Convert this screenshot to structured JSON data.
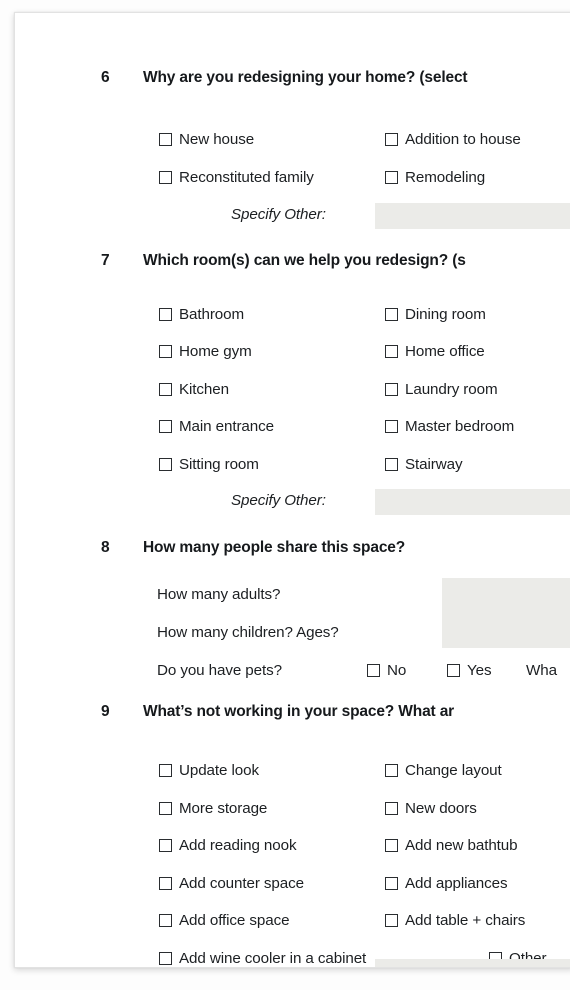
{
  "document": {
    "type": "questionnaire-form",
    "field_fill_color": "#ebebe8",
    "text_color": "#1c1f22",
    "sheet_color": "#ffffff",
    "background_color": "#fdfdfd"
  },
  "questions": [
    {
      "number": "6",
      "title": "Why are you redesigning your home? (select",
      "title_truncated": true,
      "columns": [
        [
          "New house",
          "Reconstituted family"
        ],
        [
          "Addition to house",
          "Remodeling"
        ]
      ],
      "specify_other_label": "Specify Other:",
      "specify_other_value": ""
    },
    {
      "number": "7",
      "title": "Which room(s) can we help you redesign? (s",
      "title_truncated": true,
      "columns": [
        [
          "Bathroom",
          "Home gym",
          "Kitchen",
          "Main entrance",
          "Sitting room"
        ],
        [
          "Dining room",
          "Home office",
          "Laundry room",
          "Master bedroom",
          "Stairway"
        ]
      ],
      "specify_other_label": "Specify Other:",
      "specify_other_value": ""
    },
    {
      "number": "8",
      "title": "How many people share this space?",
      "title_truncated": false,
      "sublines": [
        {
          "label": "How many adults?",
          "value": ""
        },
        {
          "label": "How many children? Ages?",
          "value": ""
        }
      ],
      "pets_label": "Do you have pets?",
      "pets_options": [
        "No",
        "Yes"
      ],
      "pets_tail": "Wha"
    },
    {
      "number": "9",
      "title": "What’s not working in your space? What ar",
      "title_truncated": true,
      "columns": [
        [
          "Update look",
          "More storage",
          "Add reading nook",
          "Add counter space",
          "Add office space"
        ],
        [
          "Change layout",
          "New doors",
          "Add new bathtub",
          "Add appliances",
          "Add table + chairs"
        ]
      ],
      "wide_option": "Add wine cooler in a cabinet",
      "other_option": "Other"
    }
  ]
}
